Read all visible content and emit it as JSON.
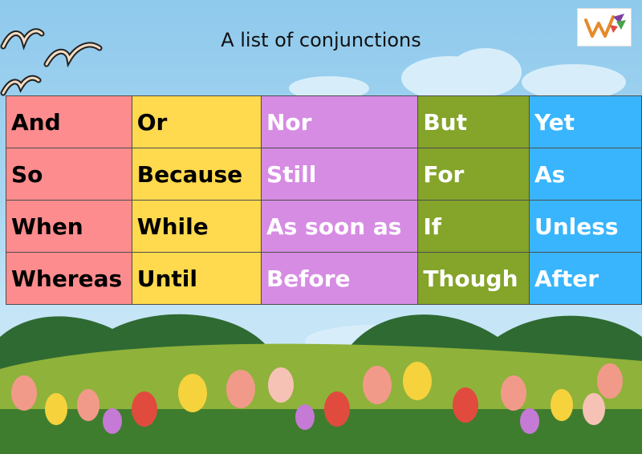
{
  "title": "A list of conjunctions",
  "colors": {
    "column_1": "#fd8c8e",
    "column_2": "#ffd94e",
    "column_3": "#d68ce3",
    "column_4": "#84a42a",
    "column_5": "#38b5fd",
    "sky": "#a8d7f2",
    "grass": "#8fb23a"
  },
  "logo": {
    "icon": "w-logo-icon"
  },
  "table": {
    "rows": [
      [
        "And",
        "Or",
        "Nor",
        "But",
        "Yet"
      ],
      [
        "So",
        "Because",
        "Still",
        "For",
        "As"
      ],
      [
        "When",
        "While",
        "As soon as",
        "If",
        "Unless"
      ],
      [
        "Whereas",
        "Until",
        "Before",
        "Though",
        "After"
      ]
    ]
  }
}
